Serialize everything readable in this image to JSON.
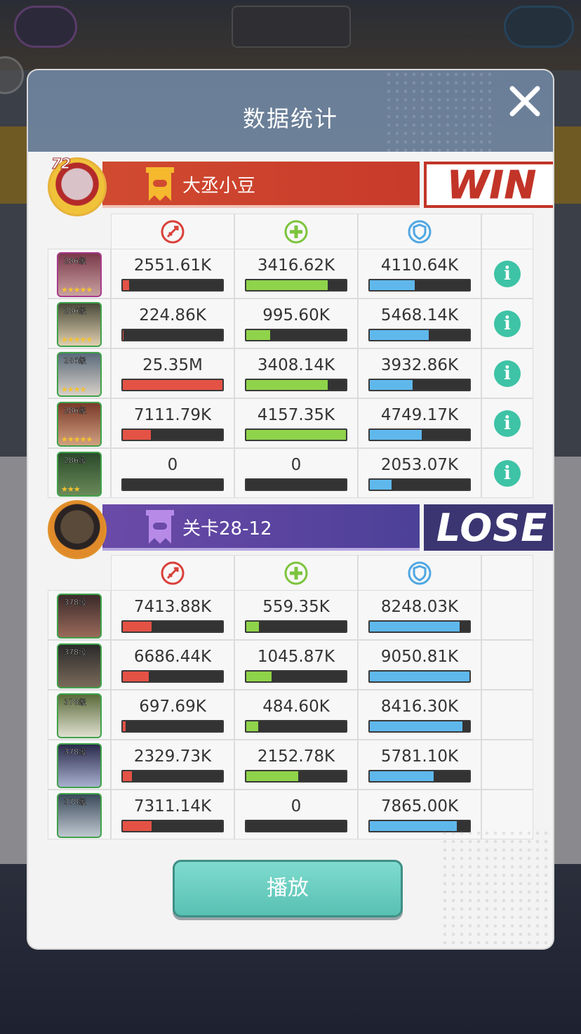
{
  "modal": {
    "title": "数据统计",
    "play_label": "播放"
  },
  "colors": {
    "damage": "#e45245",
    "heal": "#8fd34a",
    "defense": "#5fb8ec",
    "info": "#3ec3a6",
    "win": "#c23428",
    "lose": "#3b3572"
  },
  "stat_headers": [
    "damage-icon",
    "heal-icon",
    "shield-icon"
  ],
  "teams": [
    {
      "name": "大丞小豆",
      "avatar_level": "72",
      "result": "WIN",
      "heroes": [
        {
          "level": "286级",
          "damage": "2551.61K",
          "damage_ratio": 0.06,
          "heal": "3416.62K",
          "heal_ratio": 0.82,
          "defense": "4110.64K",
          "defense_ratio": 0.45
        },
        {
          "level": "286级",
          "damage": "224.86K",
          "damage_ratio": 0.01,
          "heal": "995.60K",
          "heal_ratio": 0.24,
          "defense": "5468.14K",
          "defense_ratio": 0.59
        },
        {
          "level": "286级",
          "damage": "25.35M",
          "damage_ratio": 1.0,
          "heal": "3408.14K",
          "heal_ratio": 0.82,
          "defense": "3932.86K",
          "defense_ratio": 0.43
        },
        {
          "level": "286级",
          "damage": "7111.79K",
          "damage_ratio": 0.28,
          "heal": "4157.35K",
          "heal_ratio": 1.0,
          "defense": "4749.17K",
          "defense_ratio": 0.52
        },
        {
          "level": "286级",
          "damage": "0",
          "damage_ratio": 0.0,
          "heal": "0",
          "heal_ratio": 0.0,
          "defense": "2053.07K",
          "defense_ratio": 0.22
        }
      ]
    },
    {
      "name": "关卡28-12",
      "result": "LOSE",
      "heroes": [
        {
          "level": "378级",
          "damage": "7413.88K",
          "damage_ratio": 0.29,
          "heal": "559.35K",
          "heal_ratio": 0.13,
          "defense": "8248.03K",
          "defense_ratio": 0.9
        },
        {
          "level": "378级",
          "damage": "6686.44K",
          "damage_ratio": 0.26,
          "heal": "1045.87K",
          "heal_ratio": 0.25,
          "defense": "9050.81K",
          "defense_ratio": 1.0
        },
        {
          "level": "378级",
          "damage": "697.69K",
          "damage_ratio": 0.03,
          "heal": "484.60K",
          "heal_ratio": 0.12,
          "defense": "8416.30K",
          "defense_ratio": 0.93
        },
        {
          "level": "378级",
          "damage": "2329.73K",
          "damage_ratio": 0.09,
          "heal": "2152.78K",
          "heal_ratio": 0.52,
          "defense": "5781.10K",
          "defense_ratio": 0.64
        },
        {
          "level": "378级",
          "damage": "7311.14K",
          "damage_ratio": 0.29,
          "heal": "0",
          "heal_ratio": 0.0,
          "defense": "7865.00K",
          "defense_ratio": 0.87
        }
      ]
    }
  ]
}
